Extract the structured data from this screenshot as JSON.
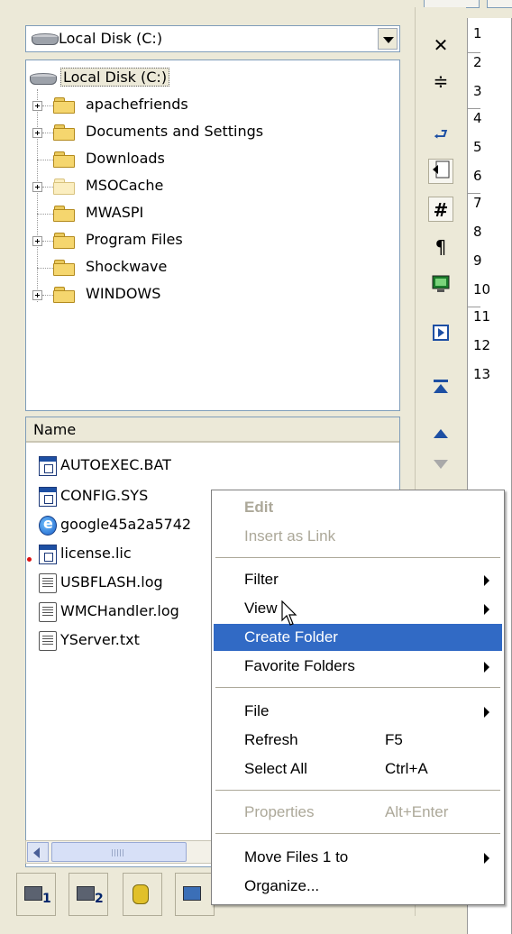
{
  "drive_combo": {
    "selected": "Local Disk (C:)"
  },
  "tree": {
    "root": "Local Disk (C:)",
    "items": [
      {
        "label": "apachefriends",
        "expandable": true
      },
      {
        "label": "Documents and Settings",
        "expandable": true
      },
      {
        "label": "Downloads",
        "expandable": false
      },
      {
        "label": "MSOCache",
        "expandable": true
      },
      {
        "label": "MWASPI",
        "expandable": false
      },
      {
        "label": "Program Files",
        "expandable": true
      },
      {
        "label": "Shockwave",
        "expandable": false
      },
      {
        "label": "WINDOWS",
        "expandable": true
      }
    ]
  },
  "file_list": {
    "header": "Name",
    "files": [
      {
        "name": "AUTOEXEC.BAT",
        "icon": "window-file-icon"
      },
      {
        "name": "CONFIG.SYS",
        "icon": "system-file-icon"
      },
      {
        "name": "google45a2a5742",
        "icon": "ie-html-icon"
      },
      {
        "name": "license.lic",
        "icon": "system-file-icon"
      },
      {
        "name": "USBFLASH.log",
        "icon": "text-file-icon"
      },
      {
        "name": "WMCHandler.log",
        "icon": "text-file-icon"
      },
      {
        "name": "YServer.txt",
        "icon": "text-file-icon"
      }
    ]
  },
  "drive_buttons": [
    {
      "sub": "1"
    },
    {
      "sub": "2"
    },
    {
      "sub": ""
    },
    {
      "sub": ""
    }
  ],
  "toolbar": {
    "close_glyph": "✕",
    "split_glyph": "≑",
    "wrap_glyph": "⮐",
    "hash_glyph": "#",
    "pilcrow_glyph": "¶"
  },
  "gutter": {
    "lines": [
      "1",
      "2",
      "3",
      "4",
      "5",
      "6",
      "7",
      "8",
      "9",
      "10",
      "11",
      "12",
      "13"
    ]
  },
  "context_menu": {
    "items": {
      "edit": "Edit",
      "insert_as_link": "Insert as Link",
      "filter": "Filter",
      "view": "View",
      "create_folder": "Create Folder",
      "favorite_folders": "Favorite Folders",
      "file": "File",
      "refresh": "Refresh",
      "refresh_shortcut": "F5",
      "select_all": "Select All",
      "select_all_shortcut": "Ctrl+A",
      "properties": "Properties",
      "properties_shortcut": "Alt+Enter",
      "move_files": "Move Files 1 to",
      "organize": "Organize..."
    }
  },
  "colors": {
    "highlight": "#316ac5",
    "window_bg": "#ece9d8",
    "disabled_text": "#aca899"
  }
}
